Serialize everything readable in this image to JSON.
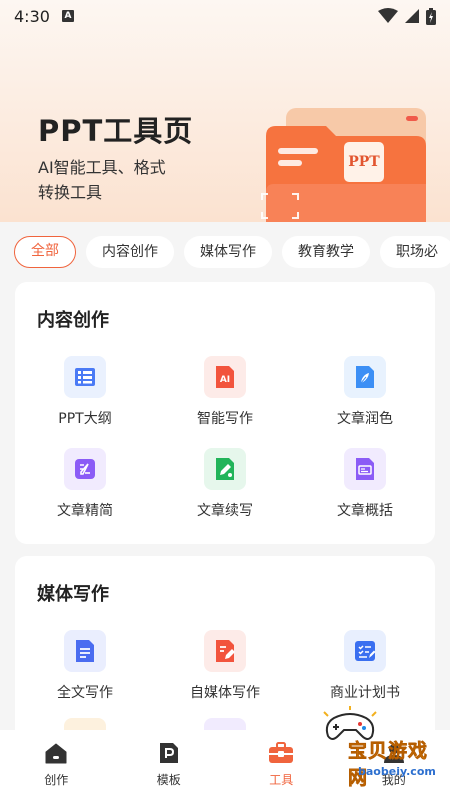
{
  "status": {
    "time": "4:30"
  },
  "hero": {
    "title": "PPT工具页",
    "subtitle_line1": "AI智能工具、格式",
    "subtitle_line2": "转换工具",
    "illustration_badge": "PPT"
  },
  "filters": [
    {
      "label": "全部",
      "active": true
    },
    {
      "label": "内容创作",
      "active": false
    },
    {
      "label": "媒体写作",
      "active": false
    },
    {
      "label": "教育教学",
      "active": false
    },
    {
      "label": "职场必",
      "active": false
    }
  ],
  "sections": [
    {
      "title": "内容创作",
      "tools": [
        {
          "label": "PPT大纲",
          "icon": "outline-list-icon",
          "color": "#4a7af5",
          "bg": "#eaf1fe"
        },
        {
          "label": "智能写作",
          "icon": "ai-document-icon",
          "color": "#f2543d",
          "bg": "#fdebe8"
        },
        {
          "label": "文章润色",
          "icon": "feather-document-icon",
          "color": "#3c8ff5",
          "bg": "#e8f2fe"
        },
        {
          "label": "文章精简",
          "icon": "condense-edit-icon",
          "color": "#8b5cf6",
          "bg": "#f1ebfe"
        },
        {
          "label": "文章续写",
          "icon": "continue-write-icon",
          "color": "#22b45a",
          "bg": "#e6f7ec"
        },
        {
          "label": "文章概括",
          "icon": "summary-card-icon",
          "color": "#8b5cf6",
          "bg": "#f1ebfe"
        }
      ]
    },
    {
      "title": "媒体写作",
      "tools": [
        {
          "label": "全文写作",
          "icon": "full-text-icon",
          "color": "#4a6cf0",
          "bg": "#eaeefe"
        },
        {
          "label": "自媒体写作",
          "icon": "media-edit-icon",
          "color": "#f2543d",
          "bg": "#fdebe8"
        },
        {
          "label": "商业计划书",
          "icon": "business-plan-icon",
          "color": "#3a6ff0",
          "bg": "#e8effe"
        }
      ]
    }
  ],
  "bottom_nav": [
    {
      "label": "创作",
      "icon": "home-icon",
      "active": false
    },
    {
      "label": "模板",
      "icon": "template-icon",
      "active": false
    },
    {
      "label": "工具",
      "icon": "toolbox-icon",
      "active": true
    },
    {
      "label": "我的",
      "icon": "profile-icon",
      "active": false
    }
  ],
  "watermark": {
    "text": "宝贝游戏网",
    "url": "baobeiy.com"
  },
  "colors": {
    "accent": "#f0643d",
    "background": "#f5f5f5",
    "card": "#ffffff"
  }
}
